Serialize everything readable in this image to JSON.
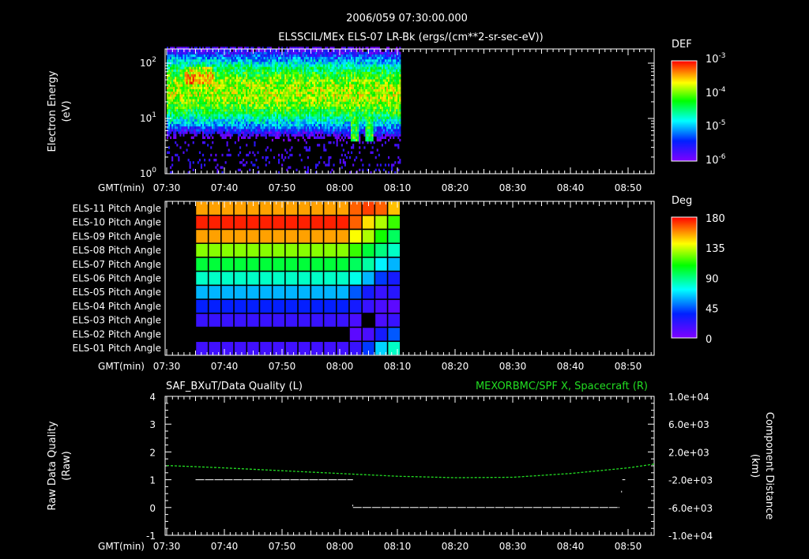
{
  "header": {
    "title_time": "2006/059 07:30:00.000",
    "title_product": "ELSSCIL/MEx ELS-07 LR-Bk  (ergs/(cm**2-sr-sec-eV))"
  },
  "chart_data": [
    {
      "type": "heatmap",
      "name": "electron-spectrogram",
      "title": "ELSSCIL/MEx ELS-07 LR-Bk  (ergs/(cm**2-sr-sec-eV))",
      "ylabel": [
        "Electron Energy",
        "(eV)"
      ],
      "xlabel": "GMT(min)",
      "x_tick_labels": [
        "07:30",
        "07:40",
        "07:50",
        "08:00",
        "08:10",
        "08:20",
        "08:30",
        "08:40",
        "08:50"
      ],
      "y_tick_labels": [
        "10^0",
        "10^1",
        "10^2"
      ],
      "y_tick_base": "10",
      "y_tick_exponents": [
        "0",
        "1",
        "2"
      ],
      "ylim_log10": [
        0,
        2.26
      ],
      "xlim_min": [
        0,
        84.5
      ],
      "data_xlim_min": [
        0,
        40.5
      ],
      "energy_core_eV": 30,
      "peak_region": {
        "time_min": [
          3,
          8
        ],
        "energy_eV": [
          40,
          80
        ],
        "log10_def": -3.1
      },
      "low_energy_spikes_min": [
        32.5,
        35
      ],
      "colorbar": {
        "label": "DEF",
        "base": "10",
        "exponents": [
          "-3",
          "-4",
          "-5",
          "-6"
        ],
        "range_log10": [
          -6.2,
          -3
        ]
      }
    },
    {
      "type": "heatmap",
      "name": "pitch-angle-grid",
      "xlabel": "GMT(min)",
      "x_tick_labels": [
        "07:30",
        "07:40",
        "07:50",
        "08:00",
        "08:10",
        "08:20",
        "08:30",
        "08:40",
        "08:50"
      ],
      "rows": [
        "ELS-11 Pitch Angle",
        "ELS-10 Pitch Angle",
        "ELS-09 Pitch Angle",
        "ELS-08 Pitch Angle",
        "ELS-07 Pitch Angle",
        "ELS-06 Pitch Angle",
        "ELS-05 Pitch Angle",
        "ELS-04 Pitch Angle",
        "ELS-03 Pitch Angle",
        "ELS-02 Pitch Angle",
        "ELS-01 Pitch Angle"
      ],
      "time_start_min": 5,
      "column_width_min": 2.22,
      "values_deg": [
        [
          155,
          155,
          155,
          155,
          155,
          155,
          155,
          155,
          155,
          155,
          155,
          155,
          165,
          170,
          165,
          150
        ],
        [
          175,
          175,
          175,
          175,
          175,
          175,
          175,
          175,
          175,
          175,
          175,
          175,
          165,
          145,
          130,
          115
        ],
        [
          155,
          155,
          155,
          155,
          155,
          155,
          155,
          155,
          155,
          155,
          155,
          155,
          140,
          130,
          110,
          95
        ],
        [
          125,
          125,
          125,
          125,
          125,
          125,
          125,
          125,
          125,
          125,
          125,
          125,
          115,
          100,
          90,
          80
        ],
        [
          100,
          100,
          100,
          100,
          100,
          100,
          100,
          100,
          100,
          100,
          100,
          100,
          95,
          85,
          70,
          60
        ],
        [
          80,
          80,
          80,
          80,
          80,
          80,
          80,
          80,
          80,
          80,
          80,
          80,
          75,
          60,
          40,
          30
        ],
        [
          60,
          60,
          60,
          60,
          60,
          60,
          60,
          60,
          60,
          60,
          60,
          60,
          45,
          30,
          20,
          25
        ],
        [
          35,
          35,
          35,
          35,
          35,
          35,
          35,
          35,
          35,
          35,
          35,
          35,
          30,
          20,
          15,
          10
        ],
        [
          20,
          20,
          20,
          20,
          20,
          20,
          20,
          20,
          20,
          20,
          20,
          20,
          15,
          null,
          15,
          20
        ],
        [
          null,
          null,
          null,
          null,
          null,
          null,
          null,
          null,
          null,
          null,
          null,
          null,
          10,
          15,
          30,
          45
        ],
        [
          18,
          18,
          18,
          18,
          18,
          18,
          18,
          18,
          18,
          18,
          18,
          18,
          20,
          40,
          65,
          80
        ]
      ],
      "colorbar": {
        "label": "Deg",
        "ticks": [
          "180",
          "135",
          "90",
          "45",
          "0"
        ],
        "range": [
          0,
          180
        ]
      }
    },
    {
      "type": "line",
      "name": "data-quality-and-position",
      "title_left": "SAF_BXuT/Data Quality (L)",
      "title_right": "MEXORBMC/SPF X, Spacecraft (R)",
      "ylabel_left": [
        "Raw Data Quality",
        "(Raw)"
      ],
      "ylabel_right": [
        "Component Distance",
        "(km)"
      ],
      "xlabel": "GMT(min)",
      "x_tick_labels": [
        "07:30",
        "07:40",
        "07:50",
        "08:00",
        "08:10",
        "08:20",
        "08:30",
        "08:40",
        "08:50"
      ],
      "y_left_ticks": [
        "4",
        "3",
        "2",
        "1",
        "0",
        "-1"
      ],
      "y_left_lim": [
        -1,
        4
      ],
      "y_right_ticks": [
        "1.0e+04",
        "6.0e+03",
        "2.0e+03",
        "-2.0e+03",
        "-6.0e+03",
        "-1.0e+04"
      ],
      "y_right_lim": [
        -10000,
        10000
      ],
      "series": [
        {
          "name": "Data Quality",
          "color": "#ffffff",
          "axis": "left",
          "segments": [
            {
              "x_min": [
                5,
                32.3
              ],
              "y": 1
            },
            {
              "x_min": [
                32.3,
                78.5
              ],
              "y": 0
            },
            {
              "x_min": [
                79,
                79.5
              ],
              "y": 1
            }
          ],
          "points": [
            {
              "x_min": 78.8,
              "y": 0.6
            },
            {
              "x_min": 32.2,
              "y": 0.1
            }
          ]
        },
        {
          "name": "SPF X",
          "color": "#22dd22",
          "axis": "right",
          "x_min": [
            0,
            10,
            20,
            30,
            40,
            50,
            60,
            70,
            80,
            84.5
          ],
          "y_km": [
            50,
            -300,
            -700,
            -1100,
            -1500,
            -1700,
            -1650,
            -1100,
            -300,
            250
          ]
        }
      ]
    }
  ]
}
